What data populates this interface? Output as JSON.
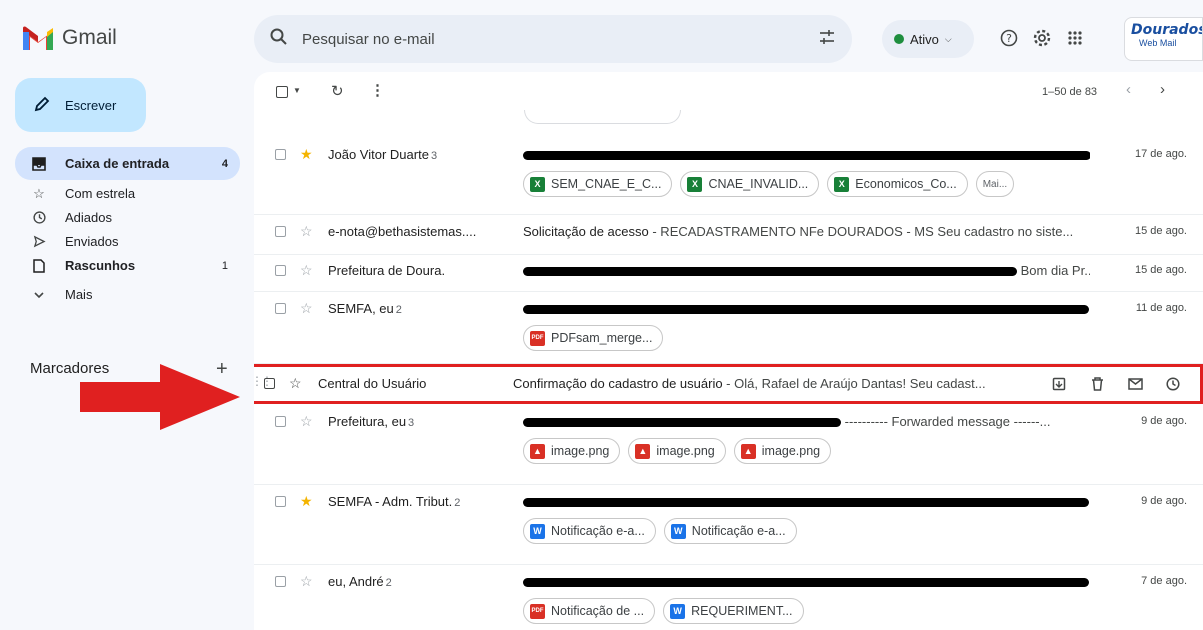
{
  "app": {
    "name": "Gmail"
  },
  "search": {
    "placeholder": "Pesquisar no e-mail"
  },
  "status": {
    "label": "Ativo"
  },
  "brand": {
    "line1": "Dourados",
    "line2": "Web Mail"
  },
  "compose": {
    "label": "Escrever"
  },
  "sidebar": {
    "items": [
      {
        "label": "Caixa de entrada",
        "count": "4",
        "icon": "inbox-icon"
      },
      {
        "label": "Com estrela",
        "count": "",
        "icon": "star-icon"
      },
      {
        "label": "Adiados",
        "count": "",
        "icon": "clock-icon"
      },
      {
        "label": "Enviados",
        "count": "",
        "icon": "send-icon"
      },
      {
        "label": "Rascunhos",
        "count": "1",
        "icon": "draft-icon"
      },
      {
        "label": "Mais",
        "count": "",
        "icon": "chevron-down-icon"
      }
    ],
    "labels_heading": "Marcadores"
  },
  "toolbar": {
    "range": "1–50 de 83"
  },
  "emails": [
    {
      "sender": "João Vitor Duarte",
      "count": "3",
      "date": "17 de ago.",
      "starred": true,
      "chips": [
        "SEM_CNAE_E_C...",
        "CNAE_INVALID...",
        "Economicos_Co...",
        "Mai..."
      ]
    },
    {
      "sender": "e-nota@bethasistemas....",
      "count": "",
      "date": "15 de ago.",
      "starred": false,
      "subject": "Solicitação de acesso",
      "snippet": " - RECADASTRAMENTO NFe DOURADOS - MS Seu cadastro no siste..."
    },
    {
      "sender": "Prefeitura de Doura.",
      "count": "",
      "date": "15 de ago.",
      "starred": false,
      "snippet": "Bom dia Pr..."
    },
    {
      "sender": "SEMFA, eu",
      "count": "2",
      "date": "11 de ago.",
      "starred": false,
      "chips": [
        "PDFsam_merge..."
      ]
    },
    {
      "sender": "Central do Usuário",
      "count": "",
      "starred": false,
      "subject": "Confirmação do cadastro de usuário",
      "snippet": " - Olá, Rafael de Araújo Dantas! Seu cadast..."
    },
    {
      "sender": "Prefeitura, eu",
      "count": "3",
      "date": "9 de ago.",
      "starred": false,
      "snippet": " ---------- Forwarded message ------...",
      "chips": [
        "image.png",
        "image.png",
        "image.png"
      ]
    },
    {
      "sender": "SEMFA - Adm. Tribut.",
      "count": "2",
      "date": "9 de ago.",
      "starred": true,
      "chips": [
        "Notificação e-a...",
        "Notificação e-a..."
      ]
    },
    {
      "sender": "eu, André",
      "count": "2",
      "date": "7 de ago.",
      "starred": false,
      "chips": [
        "Notificação de ...",
        "REQUERIMENT..."
      ]
    }
  ],
  "colors": {
    "highlight": "#e02020",
    "accent": "#c2e7ff",
    "star": "#f4b400"
  }
}
